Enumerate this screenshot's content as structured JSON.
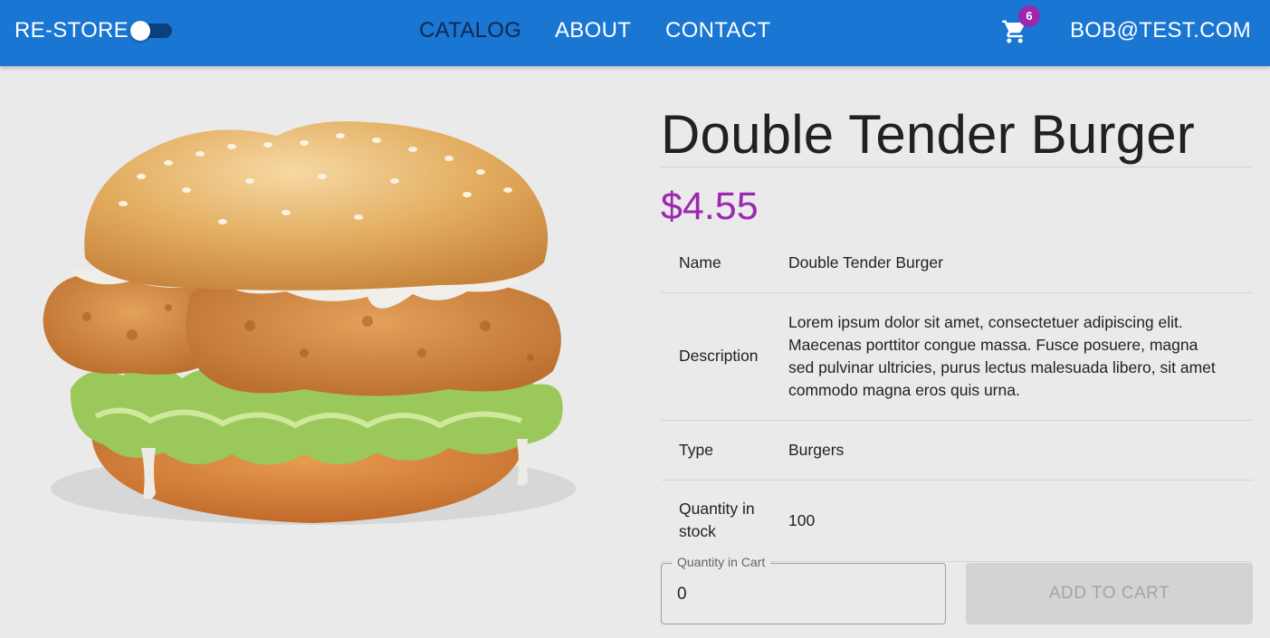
{
  "header": {
    "brand": "RE-STORE",
    "nav": [
      {
        "label": "CATALOG",
        "active": true
      },
      {
        "label": "ABOUT",
        "active": false
      },
      {
        "label": "CONTACT",
        "active": false
      }
    ],
    "cart_icon": "shopping-cart-icon",
    "cart_count": "6",
    "user": "BOB@TEST.COM",
    "dark_mode_enabled": false
  },
  "product": {
    "image_icon": "burger-photo",
    "title": "Double Tender Burger",
    "price": "$4.55",
    "details": [
      {
        "label": "Name",
        "value": "Double Tender Burger"
      },
      {
        "label": "Description",
        "value": "Lorem ipsum dolor sit amet, consectetuer adipiscing elit. Maecenas porttitor congue massa. Fusce posuere, magna sed pulvinar ultricies, purus lectus malesuada libero, sit amet commodo magna eros quis urna."
      },
      {
        "label": "Type",
        "value": "Burgers"
      },
      {
        "label": "Quantity in stock",
        "value": "100"
      }
    ]
  },
  "cart_form": {
    "quantity_label": "Quantity in Cart",
    "quantity_value": "0",
    "add_button": "ADD TO CART"
  },
  "colors": {
    "appbar": "#1976d2",
    "badge": "#9c27b0",
    "price": "#9c27b0",
    "background": "#eaeaea"
  }
}
